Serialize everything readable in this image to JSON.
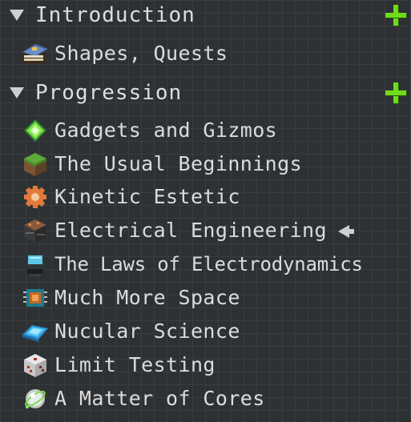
{
  "categories": [
    {
      "title": "Introduction",
      "quests": [
        {
          "label": "Shapes, Quests",
          "icon": "spellbook-icon"
        }
      ]
    },
    {
      "title": "Progression",
      "quests": [
        {
          "label": "Gadgets and Gizmos",
          "icon": "green-gem-icon"
        },
        {
          "label": "The Usual Beginnings",
          "icon": "grass-block-icon"
        },
        {
          "label": "Kinetic Estetic",
          "icon": "gear-icon"
        },
        {
          "label": "Electrical Engineering",
          "icon": "machine-block-icon",
          "pinned": true
        },
        {
          "label": "The Laws of Electrodynamics",
          "icon": "computer-terminal-icon"
        },
        {
          "label": "Much More Space",
          "icon": "microchip-icon"
        },
        {
          "label": "Nucular Science",
          "icon": "cyan-ingot-icon"
        },
        {
          "label": "Limit Testing",
          "icon": "dice-block-icon"
        },
        {
          "label": "A Matter of Cores",
          "icon": "matter-core-icon"
        }
      ]
    }
  ],
  "colors": {
    "background": "#2e3134",
    "text": "#dcdcdc",
    "add_button": "#6fdc1a"
  }
}
